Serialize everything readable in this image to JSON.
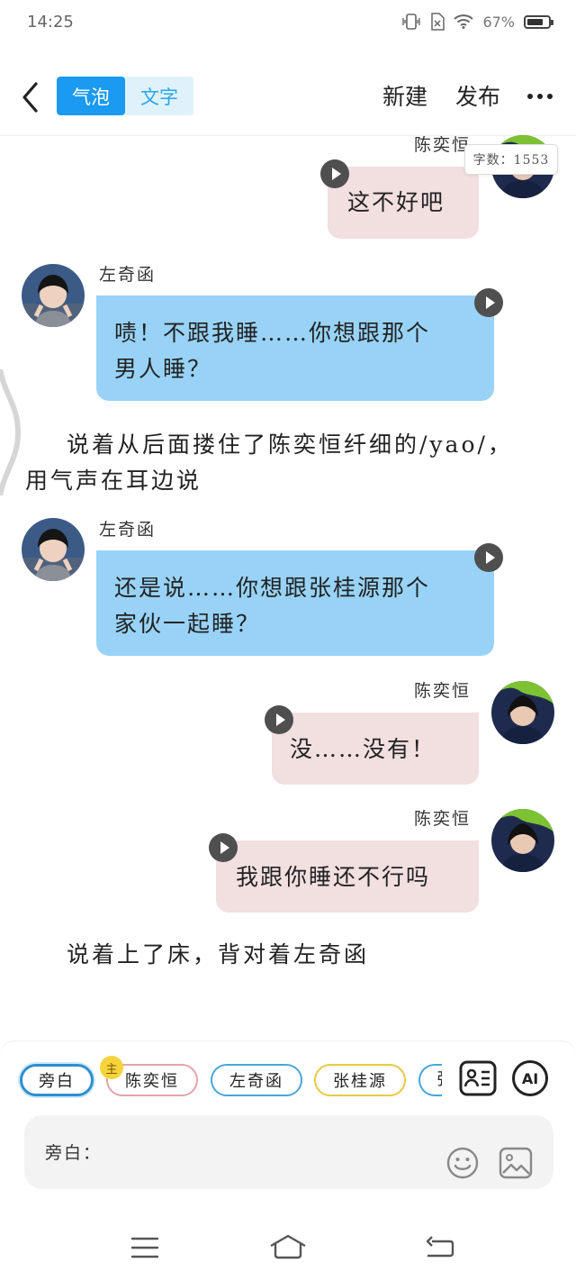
{
  "status_bar": {
    "time": "14:25",
    "battery": "67%"
  },
  "header": {
    "tabs": [
      {
        "label": "气泡",
        "active": true
      },
      {
        "label": "文字",
        "active": false
      }
    ],
    "new_label": "新建",
    "publish_label": "发布"
  },
  "word_count": "字数：1553",
  "messages": [
    {
      "type": "bubble",
      "speaker": "陈奕恒",
      "side": "right",
      "text": "这不好吧"
    },
    {
      "type": "bubble",
      "speaker": "左奇函",
      "side": "left",
      "line1": "啧！不跟我睡……你想跟那个",
      "line2": "男人睡？"
    },
    {
      "type": "narration",
      "line1": "说着从后面搂住了陈奕恒纤细的/yao/，",
      "line2": "用气声在耳边说"
    },
    {
      "type": "bubble",
      "speaker": "左奇函",
      "side": "left",
      "line1": "还是说……你想跟张桂源那个",
      "line2": "家伙一起睡？"
    },
    {
      "type": "bubble",
      "speaker": "陈奕恒",
      "side": "right",
      "text": "没……没有！"
    },
    {
      "type": "bubble",
      "speaker": "陈奕恒",
      "side": "right",
      "text": "我跟你睡还不行吗"
    },
    {
      "type": "narration",
      "line1": "说着上了床，背对着左奇函"
    }
  ],
  "roles": [
    {
      "label": "旁白",
      "color": "#2d8fd0",
      "selected": true
    },
    {
      "label": "陈奕恒",
      "color": "#e3a5a8",
      "badge": "主"
    },
    {
      "label": "左奇函",
      "color": "#46a7d9"
    },
    {
      "label": "张桂源",
      "color": "#e8c84a"
    },
    {
      "label": "张",
      "color": "#46a7d9"
    }
  ],
  "composer": {
    "label": "旁白："
  },
  "ai_label": "AI",
  "colors": {
    "accent": "#1a9af0",
    "left_bubble": "#98d3f7",
    "right_bubble": "#f2dfe0"
  }
}
